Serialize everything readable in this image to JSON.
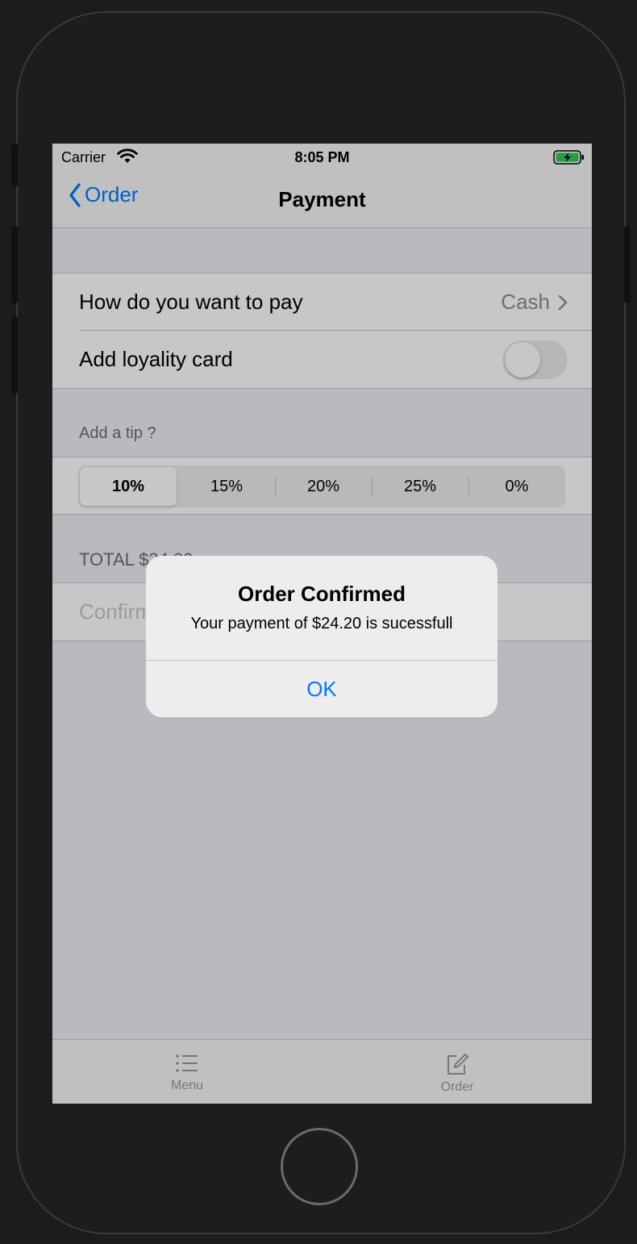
{
  "status_bar": {
    "carrier": "Carrier",
    "time": "8:05 PM"
  },
  "nav": {
    "back_label": "Order",
    "title": "Payment"
  },
  "payment_section": {
    "method_label": "How do you want to pay",
    "method_value": "Cash",
    "loyalty_label": "Add loyality card",
    "loyalty_enabled": false
  },
  "tip_section": {
    "header": "Add a tip ?",
    "options": [
      "10%",
      "15%",
      "20%",
      "25%",
      "0%"
    ],
    "selected": "10%"
  },
  "total_section": {
    "header": "TOTAL $24.20",
    "confirm_label": "Confirm"
  },
  "alert": {
    "title": "Order Confirmed",
    "message": "Your payment of $24.20 is sucessfull",
    "button": "OK"
  },
  "tab_bar": {
    "items": [
      {
        "label": "Menu",
        "icon": "list-icon"
      },
      {
        "label": "Order",
        "icon": "compose-icon"
      }
    ]
  },
  "colors": {
    "accent": "#007aff"
  }
}
